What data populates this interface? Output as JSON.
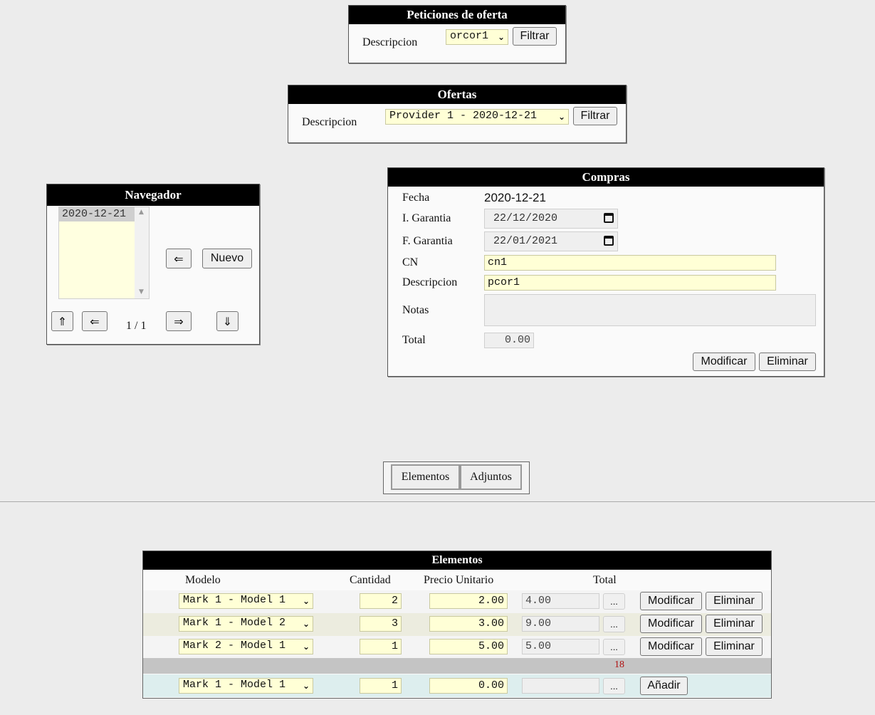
{
  "peticiones": {
    "title": "Peticiones de oferta",
    "descripcion_label": "Descripcion",
    "select_value": "orcor1",
    "filter_button": "Filtrar"
  },
  "ofertas": {
    "title": "Ofertas",
    "descripcion_label": "Descripcion",
    "select_value": "Provider 1 - 2020-12-21",
    "filter_button": "Filtrar"
  },
  "navegador": {
    "title": "Navegador",
    "list_items": [
      "2020-12-21"
    ],
    "back_arrow": "⇐",
    "new_button": "Nuevo",
    "first_arrow": "⇑",
    "prev_arrow": "⇐",
    "page_indicator": "1 / 1",
    "next_arrow": "⇒",
    "last_arrow": "⇓"
  },
  "compras": {
    "title": "Compras",
    "fecha_label": "Fecha",
    "fecha_value": "2020-12-21",
    "i_garantia_label": "I. Garantia",
    "i_garantia_value": "22/12/2020",
    "f_garantia_label": "F. Garantia",
    "f_garantia_value": "22/01/2021",
    "cn_label": "CN",
    "cn_value": "cn1",
    "descripcion_label": "Descripcion",
    "descripcion_value": "pcor1",
    "notas_label": "Notas",
    "notas_value": "",
    "total_label": "Total",
    "total_value": "0.00",
    "modify_button": "Modificar",
    "delete_button": "Eliminar"
  },
  "tabs": [
    {
      "label": "Elementos"
    },
    {
      "label": "Adjuntos"
    }
  ],
  "elementos": {
    "title": "Elementos",
    "headers": {
      "modelo": "Modelo",
      "cantidad": "Cantidad",
      "precio": "Precio Unitario",
      "total": "Total"
    },
    "rows": [
      {
        "modelo": "Mark 1 - Model 1",
        "cantidad": "2",
        "precio": "2.00",
        "total": "4.00",
        "more": "...",
        "modify": "Modificar",
        "delete": "Eliminar"
      },
      {
        "modelo": "Mark 1 - Model 2",
        "cantidad": "3",
        "precio": "3.00",
        "total": "9.00",
        "more": "...",
        "modify": "Modificar",
        "delete": "Eliminar"
      },
      {
        "modelo": "Mark 2 - Model 1",
        "cantidad": "1",
        "precio": "5.00",
        "total": "5.00",
        "more": "...",
        "modify": "Modificar",
        "delete": "Eliminar"
      }
    ],
    "sum_total": "18",
    "new_row": {
      "modelo": "Mark 1 - Model 1",
      "cantidad": "1",
      "precio": "0.00",
      "total": "",
      "more": "...",
      "add": "Añadir"
    }
  },
  "colors": {
    "title_bg": "#000000",
    "input_bg": "#ffffd6",
    "row_alt_bg": "#ececdf",
    "sum_row_bg": "#c4c4c4",
    "new_row_bg": "#ddeeee",
    "sum_text": "#b01010"
  }
}
